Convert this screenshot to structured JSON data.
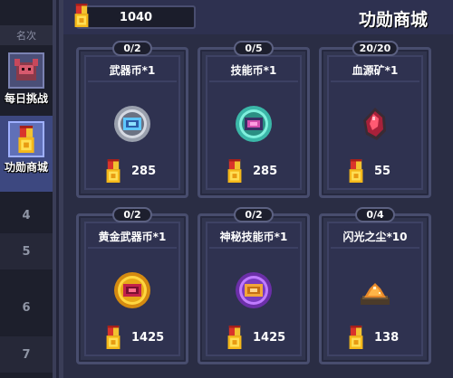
{
  "currency": {
    "amount": "1040"
  },
  "title": "功勋商城",
  "rail": {
    "header": "名次",
    "daily_label": "每日挑战",
    "shop_label": "功勋商城",
    "ranks": [
      "4",
      "5",
      "6",
      "7"
    ]
  },
  "items": [
    {
      "badge": "0/2",
      "name": "武器币*1",
      "price": "285",
      "icon": "weapon-coin-icon"
    },
    {
      "badge": "0/5",
      "name": "技能币*1",
      "price": "285",
      "icon": "skill-coin-icon"
    },
    {
      "badge": "20/20",
      "name": "血源矿*1",
      "price": "55",
      "icon": "blood-ore-icon"
    },
    {
      "badge": "0/2",
      "name": "黄金武器币*1",
      "price": "1425",
      "icon": "gold-weapon-coin-icon"
    },
    {
      "badge": "0/2",
      "name": "神秘技能币*1",
      "price": "1425",
      "icon": "mystery-skill-coin-icon"
    },
    {
      "badge": "0/4",
      "name": "闪光之尘*10",
      "price": "138",
      "icon": "glitter-dust-icon"
    }
  ]
}
